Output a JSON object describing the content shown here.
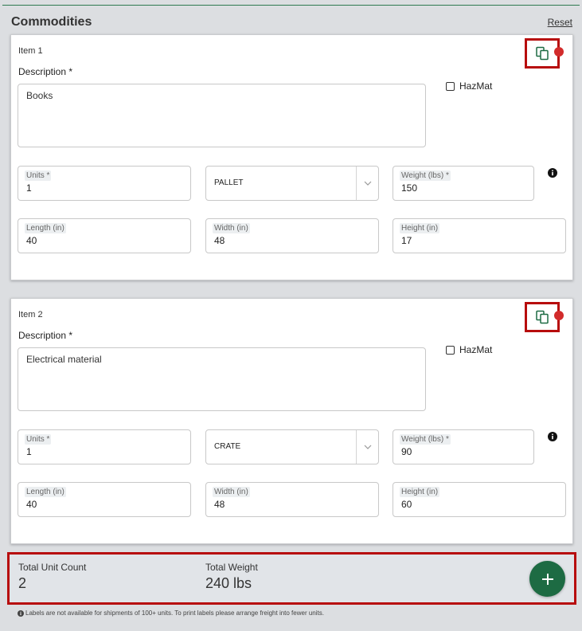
{
  "header": {
    "title": "Commodities",
    "reset_label": "Reset"
  },
  "items": [
    {
      "title": "Item 1",
      "description_label": "Description *",
      "description": "Books",
      "hazmat_label": "HazMat",
      "units_label": "Units *",
      "units": "1",
      "package_type": "PALLET",
      "weight_label": "Weight (lbs) *",
      "weight": "150",
      "length_label": "Length (in)",
      "length": "40",
      "width_label": "Width (in)",
      "width": "48",
      "height_label": "Height (in)",
      "height": "17"
    },
    {
      "title": "Item 2",
      "description_label": "Description *",
      "description": "Electrical material",
      "hazmat_label": "HazMat",
      "units_label": "Units *",
      "units": "1",
      "package_type": "CRATE",
      "weight_label": "Weight (lbs) *",
      "weight": "90",
      "length_label": "Length (in)",
      "length": "40",
      "width_label": "Width (in)",
      "width": "48",
      "height_label": "Height (in)",
      "height": "60"
    }
  ],
  "totals": {
    "unit_count_label": "Total Unit Count",
    "unit_count": "2",
    "weight_label": "Total Weight",
    "weight": "240 lbs"
  },
  "footer_note": "Labels are not available for shipments of 100+ units. To print labels please arrange freight into fewer units.",
  "colors": {
    "accent_green": "#1d6b43",
    "highlight_red": "#b70d0d",
    "status_red": "#d22b2b"
  },
  "icons": {
    "copy": "copy-icon",
    "add": "plus-icon",
    "info": "info-icon",
    "dropdown": "chevron-down-icon"
  }
}
